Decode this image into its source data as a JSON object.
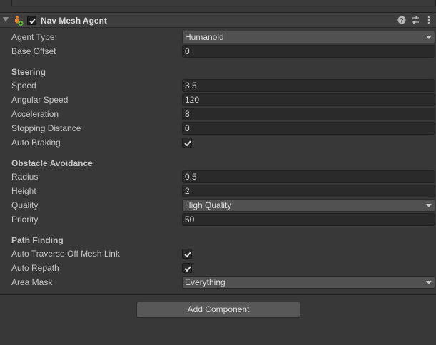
{
  "component": {
    "title": "Nav Mesh Agent",
    "enabled": true,
    "icons": [
      "help-icon",
      "preset-icon",
      "more-menu-icon"
    ]
  },
  "fields": {
    "agent_type": {
      "label": "Agent Type",
      "value": "Humanoid"
    },
    "base_offset": {
      "label": "Base Offset",
      "value": "0"
    }
  },
  "steering": {
    "heading": "Steering",
    "speed": {
      "label": "Speed",
      "value": "3.5"
    },
    "angular_speed": {
      "label": "Angular Speed",
      "value": "120"
    },
    "acceleration": {
      "label": "Acceleration",
      "value": "8"
    },
    "stopping_distance": {
      "label": "Stopping Distance",
      "value": "0"
    },
    "auto_braking": {
      "label": "Auto Braking",
      "checked": true
    }
  },
  "obstacle_avoidance": {
    "heading": "Obstacle Avoidance",
    "radius": {
      "label": "Radius",
      "value": "0.5"
    },
    "height": {
      "label": "Height",
      "value": "2"
    },
    "quality": {
      "label": "Quality",
      "value": "High Quality"
    },
    "priority": {
      "label": "Priority",
      "value": "50"
    }
  },
  "path_finding": {
    "heading": "Path Finding",
    "auto_traverse": {
      "label": "Auto Traverse Off Mesh Link",
      "checked": true
    },
    "auto_repath": {
      "label": "Auto Repath",
      "checked": true
    },
    "area_mask": {
      "label": "Area Mask",
      "value": "Everything"
    }
  },
  "add_component_label": "Add Component",
  "colors": {
    "background": "#383838",
    "field_bg": "#2a2a2a",
    "dropdown_bg": "#515151",
    "button_bg": "#585858"
  }
}
